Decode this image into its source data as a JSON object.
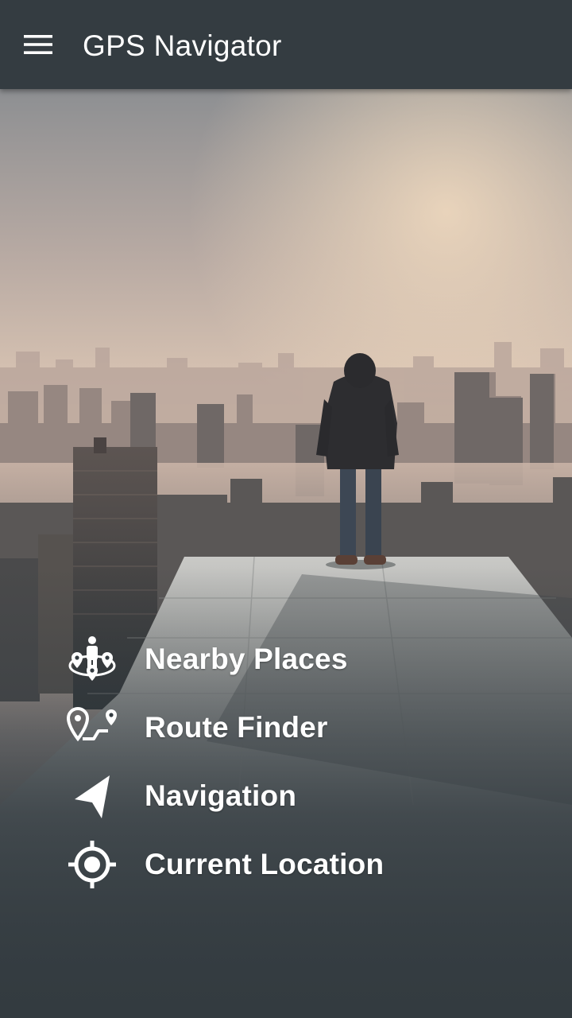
{
  "toolbar": {
    "title": "GPS Navigator",
    "menu_icon": "hamburger-menu-icon"
  },
  "menu": {
    "items": [
      {
        "label": "Nearby Places",
        "icon": "nearby-places-icon"
      },
      {
        "label": "Route Finder",
        "icon": "route-finder-icon"
      },
      {
        "label": "Navigation",
        "icon": "navigation-arrow-icon"
      },
      {
        "label": "Current Location",
        "icon": "current-location-icon"
      }
    ]
  },
  "colors": {
    "toolbar": "#343c41",
    "background": "#333b40",
    "text": "#ffffff"
  }
}
